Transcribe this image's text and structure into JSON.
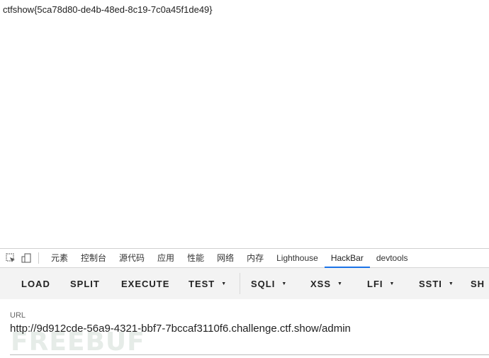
{
  "page": {
    "flag_text": "ctfshow{5ca78d80-de4b-48ed-8c19-7c0a45f1de49}"
  },
  "devtools": {
    "tabs": [
      {
        "label": "元素"
      },
      {
        "label": "控制台"
      },
      {
        "label": "源代码"
      },
      {
        "label": "应用"
      },
      {
        "label": "性能"
      },
      {
        "label": "网络"
      },
      {
        "label": "内存"
      },
      {
        "label": "Lighthouse"
      },
      {
        "label": "HackBar",
        "active": true
      },
      {
        "label": "devtools"
      }
    ],
    "accent": "#1a73e8"
  },
  "hackbar": {
    "buttons": [
      {
        "label": "LOAD"
      },
      {
        "label": "SPLIT"
      },
      {
        "label": "EXECUTE"
      },
      {
        "label": "TEST",
        "dropdown": true
      },
      {
        "label": "SQLI",
        "dropdown": true
      },
      {
        "label": "XSS",
        "dropdown": true
      },
      {
        "label": "LFI",
        "dropdown": true
      },
      {
        "label": "SSTI",
        "dropdown": true
      },
      {
        "label": "SH"
      }
    ],
    "url_label": "URL",
    "url_value": "http://9d912cde-56a9-4321-bbf7-7bccaf3110f6.challenge.ctf.show/admin"
  },
  "watermark": "FREEBUF"
}
